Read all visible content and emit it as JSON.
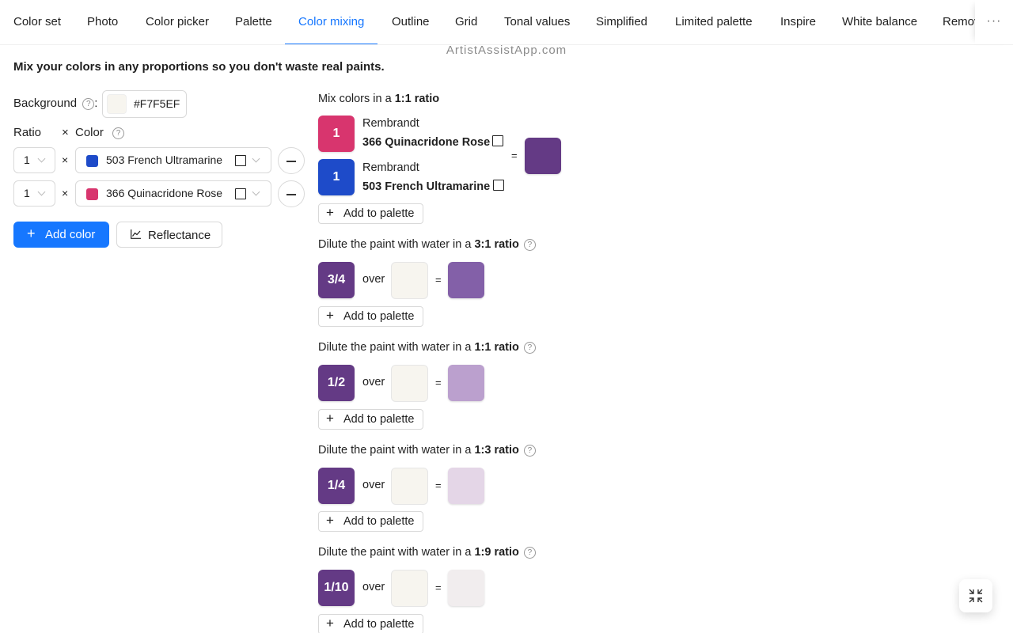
{
  "tabs": [
    {
      "label": "Color set"
    },
    {
      "label": "Photo"
    },
    {
      "label": "Color picker"
    },
    {
      "label": "Palette"
    },
    {
      "label": "Color mixing",
      "active": true
    },
    {
      "label": "Outline"
    },
    {
      "label": "Grid"
    },
    {
      "label": "Tonal values"
    },
    {
      "label": "Simplified"
    },
    {
      "label": "Limited palette"
    },
    {
      "label": "Inspire"
    },
    {
      "label": "White balance"
    },
    {
      "label": "Remove background"
    }
  ],
  "more_label": "···",
  "watermark": "ArtistAssistApp.com",
  "intro": "Mix your colors in any proportions so you don't waste real paints.",
  "background": {
    "label": "Background",
    "colon": ":",
    "value": "#F7F5EF"
  },
  "table_header": {
    "ratio": "Ratio",
    "times": "×",
    "color": "Color"
  },
  "rows": [
    {
      "ratio": "1",
      "times": "×",
      "color_name": "503 French Ultramarine",
      "swatch": "#1E4BC9"
    },
    {
      "ratio": "1",
      "times": "×",
      "color_name": "366 Quinacridone Rose",
      "swatch": "#D8356E"
    }
  ],
  "buttons": {
    "add_color": "Add color",
    "reflectance": "Reflectance",
    "add_to_palette": "Add to palette"
  },
  "mix": {
    "title_prefix": "Mix colors in a ",
    "title_ratio": "1:1 ratio",
    "components": [
      {
        "parts": "1",
        "brand": "Rembrandt",
        "name": "366 Quinacridone Rose",
        "color": "#D8356E"
      },
      {
        "parts": "1",
        "brand": "Rembrandt",
        "name": "503 French Ultramarine",
        "color": "#1E4BC9"
      }
    ],
    "equals": "=",
    "result_color": "#643A85"
  },
  "dilutions": [
    {
      "title_prefix": "Dilute the paint with water in a ",
      "title_ratio": "3:1 ratio",
      "fraction": "3/4",
      "over": "over",
      "equals": "=",
      "result_color": "#8360A8"
    },
    {
      "title_prefix": "Dilute the paint with water in a ",
      "title_ratio": "1:1 ratio",
      "fraction": "1/2",
      "over": "over",
      "equals": "=",
      "result_color": "#BBA0CE"
    },
    {
      "title_prefix": "Dilute the paint with water in a ",
      "title_ratio": "1:3 ratio",
      "fraction": "1/4",
      "over": "over",
      "equals": "=",
      "result_color": "#E4D6E7"
    },
    {
      "title_prefix": "Dilute the paint with water in a ",
      "title_ratio": "1:9 ratio",
      "fraction": "1/10",
      "over": "over",
      "equals": "=",
      "result_color": "#F1EDEE"
    }
  ],
  "colors": {
    "accent": "#1677FF",
    "paint_tile": "#643A85",
    "background_swatch": "#F7F5EF"
  },
  "icons": [
    "help-icon",
    "chevron-down-icon",
    "minus-icon",
    "plus-icon",
    "line-chart-icon",
    "fullscreen-exit-icon",
    "more-icon"
  ]
}
